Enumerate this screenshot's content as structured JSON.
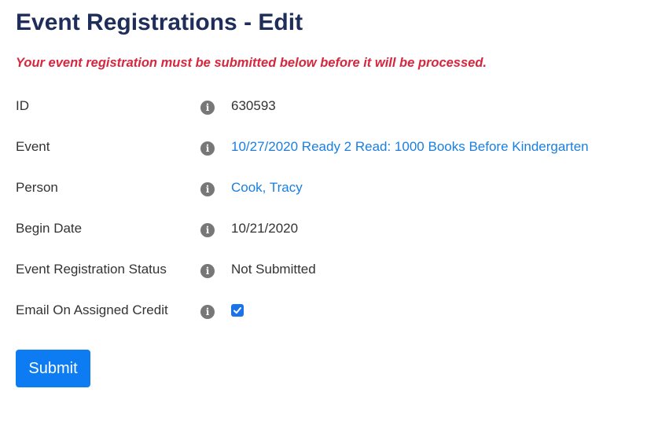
{
  "page": {
    "title": "Event Registrations - Edit",
    "notice": "Your event registration must be submitted below before it will be processed."
  },
  "fields": {
    "id": {
      "label": "ID",
      "value": "630593",
      "icon": "info-icon"
    },
    "event": {
      "label": "Event",
      "value": "10/27/2020 Ready 2 Read: 1000 Books Before Kindergarten",
      "icon": "info-icon"
    },
    "person": {
      "label": "Person",
      "value": "Cook, Tracy",
      "icon": "info-icon"
    },
    "begin_date": {
      "label": "Begin Date",
      "value": "10/21/2020",
      "icon": "info-icon"
    },
    "status": {
      "label": "Event Registration Status",
      "value": "Not Submitted",
      "icon": "info-icon"
    },
    "email_on_credit": {
      "label": "Email On Assigned Credit",
      "checked": true,
      "icon": "info-icon"
    }
  },
  "actions": {
    "submit_label": "Submit"
  },
  "colors": {
    "title": "#1f2d5a",
    "notice": "#d7263d",
    "link": "#1a7fe0",
    "button": "#0d7cf2",
    "icon": "#777777"
  }
}
